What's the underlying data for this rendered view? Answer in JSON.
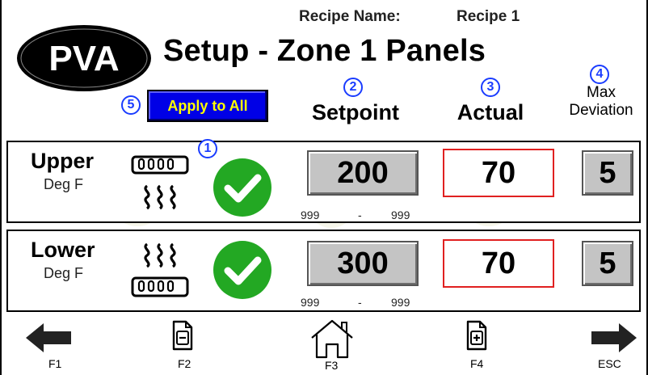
{
  "header": {
    "logo_text": "PVA",
    "recipe_label": "Recipe Name:",
    "recipe_name": "Recipe 1",
    "title": "Setup - Zone 1 Panels"
  },
  "callouts": [
    "1",
    "2",
    "3",
    "4",
    "5"
  ],
  "apply_all_label": "Apply to All",
  "columns": {
    "setpoint": "Setpoint",
    "actual": "Actual",
    "max_line1": "Max",
    "max_line2": "Deviation"
  },
  "rows": [
    {
      "label": "Upper",
      "unit": "Deg F",
      "icon": "upper-heater-icon",
      "enabled": true,
      "setpoint": "200",
      "range_min": "999",
      "range_sep": "-",
      "range_max": "999",
      "actual": "70",
      "max_deviation": "5"
    },
    {
      "label": "Lower",
      "unit": "Deg F",
      "icon": "lower-heater-icon",
      "enabled": true,
      "setpoint": "300",
      "range_min": "999",
      "range_sep": "-",
      "range_max": "999",
      "actual": "70",
      "max_deviation": "5"
    }
  ],
  "footer": {
    "f1": "F1",
    "f2": "F2",
    "f3": "F3",
    "f4": "F4",
    "esc": "ESC"
  },
  "colors": {
    "apply_bg": "#0000e6",
    "apply_text": "#ffff00",
    "callout": "#1a3cff",
    "check_green": "#23a823",
    "actual_border": "#e02020",
    "input_gray": "#c4c4c4"
  }
}
